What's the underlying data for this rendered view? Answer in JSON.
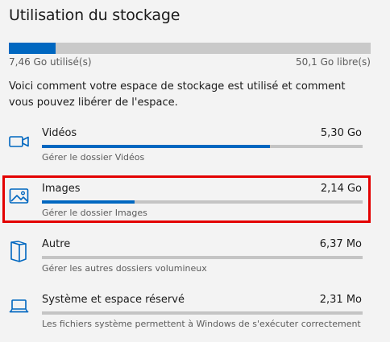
{
  "header": {
    "title": "Utilisation du stockage"
  },
  "overall": {
    "used_label": "7,46 Go utilisé(s)",
    "free_label": "50,1 Go libre(s)",
    "used_fraction": 0.13
  },
  "description": "Voici comment votre espace de stockage est utilisé et comment vous pouvez libérer de l'espace.",
  "categories": [
    {
      "name": "Vidéos",
      "size": "5,30 Go",
      "link": "Gérer le dossier Vidéos",
      "usage_fraction": 0.71,
      "icon": "video-camera-icon"
    },
    {
      "name": "Images",
      "size": "2,14 Go",
      "link": "Gérer le dossier Images",
      "usage_fraction": 0.29,
      "icon": "image-icon"
    },
    {
      "name": "Autre",
      "size": "6,37 Mo",
      "link": "Gérer les autres dossiers volumineux",
      "usage_fraction": 0.0,
      "icon": "folder-icon"
    },
    {
      "name": "Système et espace réservé",
      "size": "2,31 Mo",
      "link": "Les fichiers système permettent à Windows de s'exécuter correctement",
      "usage_fraction": 0.0,
      "icon": "laptop-icon"
    }
  ],
  "colors": {
    "accent": "#0067c0",
    "track": "#c4c4c4",
    "highlight": "#e30000"
  }
}
